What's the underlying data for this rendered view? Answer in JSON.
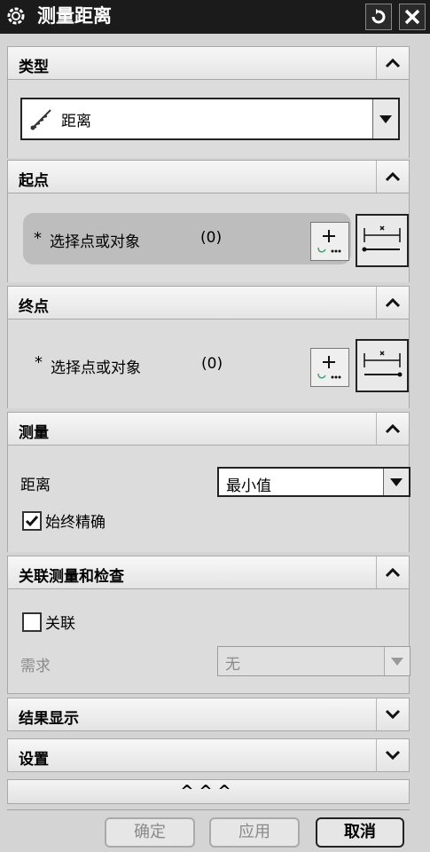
{
  "window": {
    "title": "测量距离",
    "reset_icon": "reset-icon",
    "close_icon": "close-icon"
  },
  "sections": {
    "type": {
      "title": "类型",
      "selected": "距离"
    },
    "start": {
      "title": "起点",
      "prompt": "选择点或对象",
      "count": "(0)"
    },
    "end": {
      "title": "终点",
      "prompt": "选择点或对象",
      "count": "(0)"
    },
    "measure": {
      "title": "测量",
      "distance_label": "距离",
      "distance_value": "最小值",
      "always_exact_label": "始终精确",
      "always_exact_checked": true
    },
    "assoc": {
      "title": "关联测量和检查",
      "assoc_label": "关联",
      "assoc_checked": false,
      "require_label": "需求",
      "require_value": "无"
    },
    "results": {
      "title": "结果显示"
    },
    "settings": {
      "title": "设置"
    }
  },
  "more_glyph": "^^^",
  "buttons": {
    "ok": "确定",
    "apply": "应用",
    "cancel": "取消"
  }
}
